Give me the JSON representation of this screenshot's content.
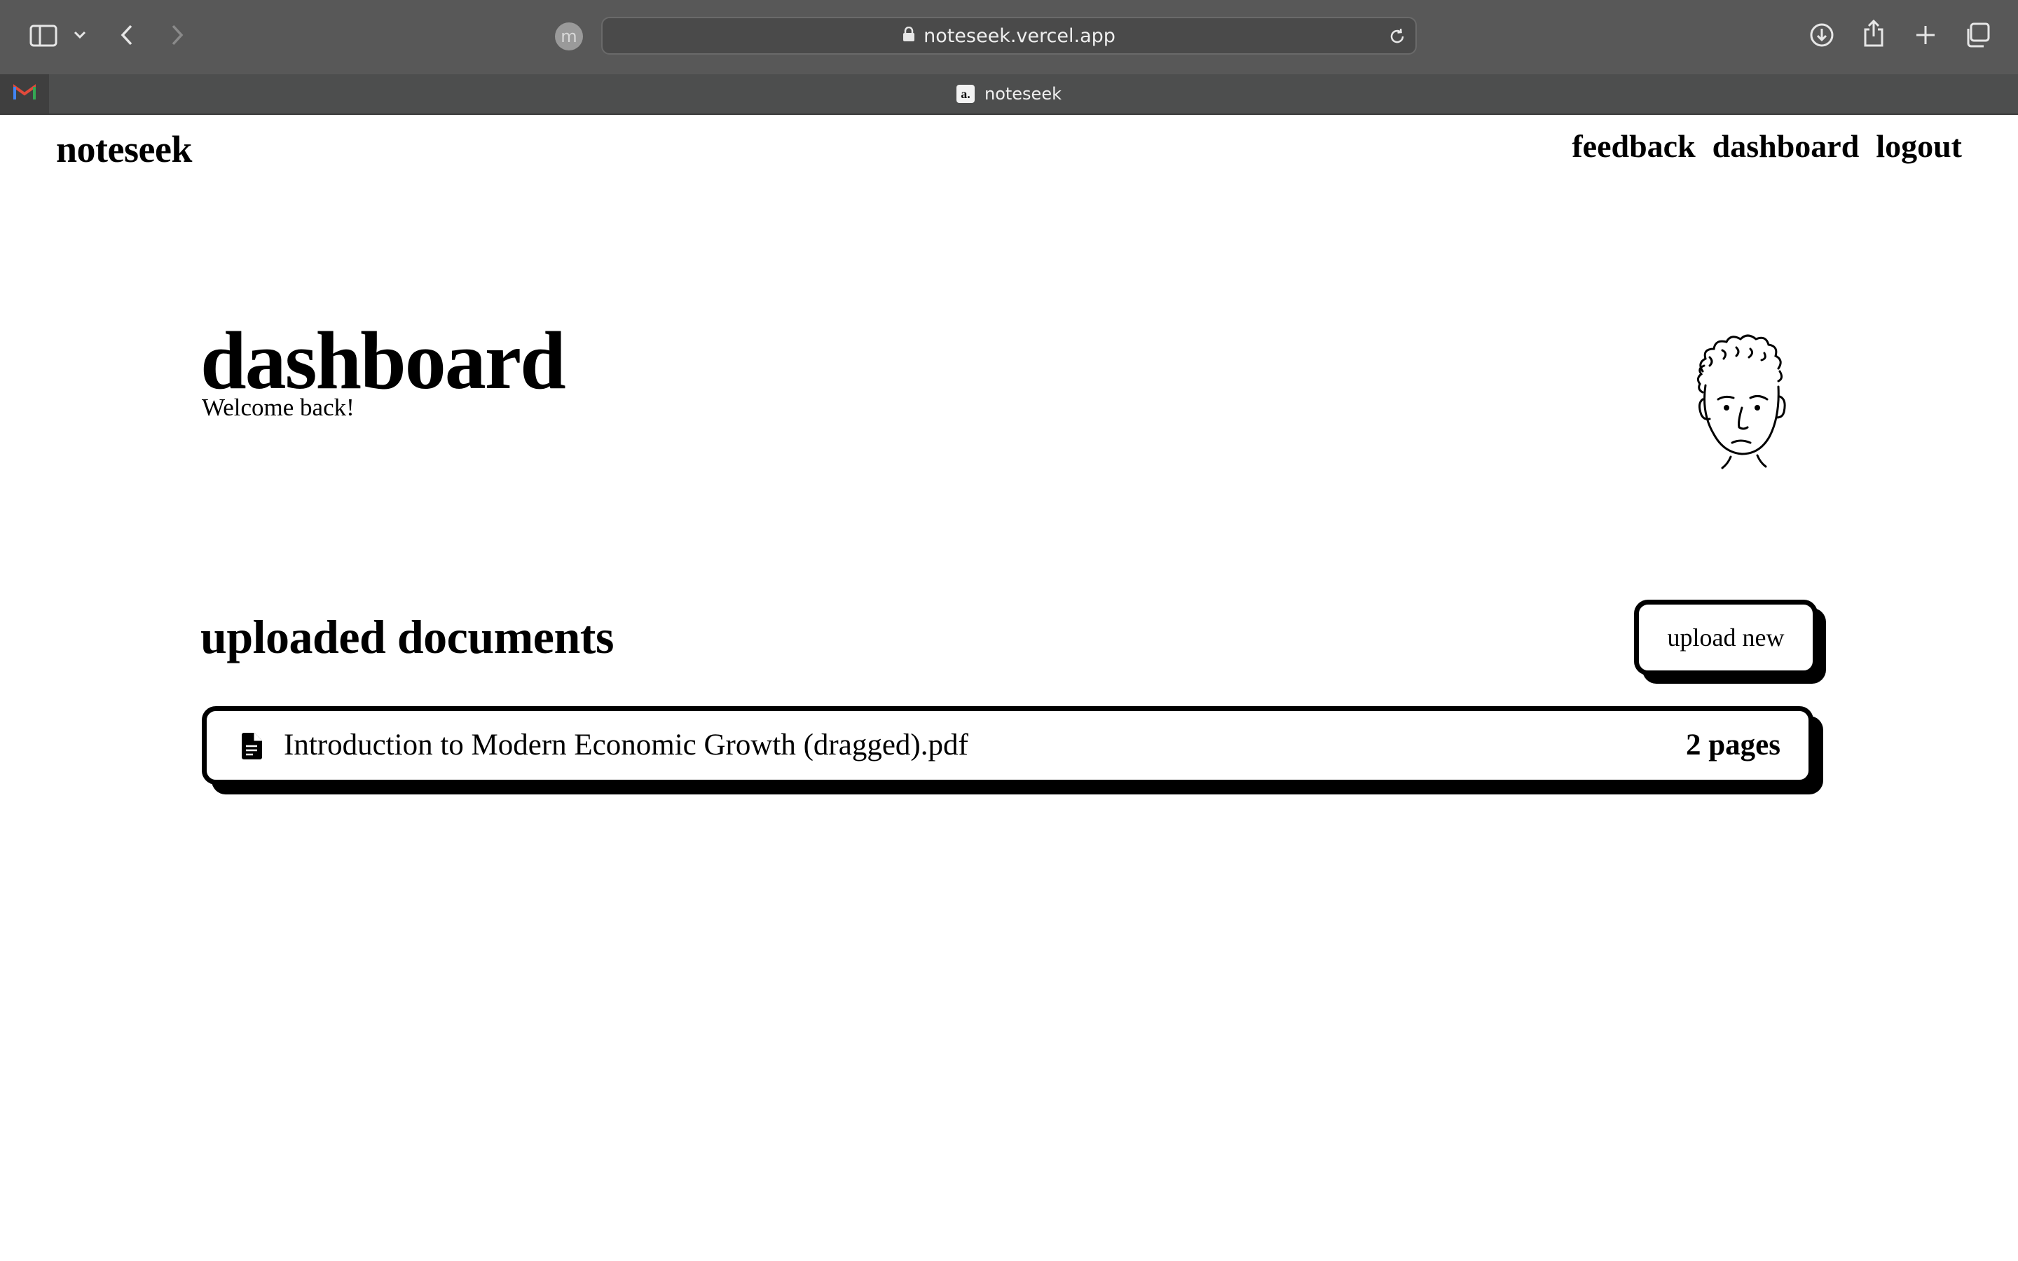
{
  "browser": {
    "url": "noteseek.vercel.app",
    "profile_initial": "m",
    "active_tab_title": "noteseek",
    "favicon_letter": "a."
  },
  "header": {
    "logo": "noteseek",
    "nav": [
      "feedback",
      "dashboard",
      "logout"
    ]
  },
  "main": {
    "title": "dashboard",
    "subtitle": "Welcome back!",
    "section_title": "uploaded documents",
    "upload_button": "upload new",
    "documents": [
      {
        "name": "Introduction to Modern Economic Growth (dragged).pdf",
        "pages": "2 pages"
      }
    ]
  },
  "colors": {
    "chrome_bg": "#585858",
    "page_bg": "#ffffff",
    "ink": "#000000"
  }
}
